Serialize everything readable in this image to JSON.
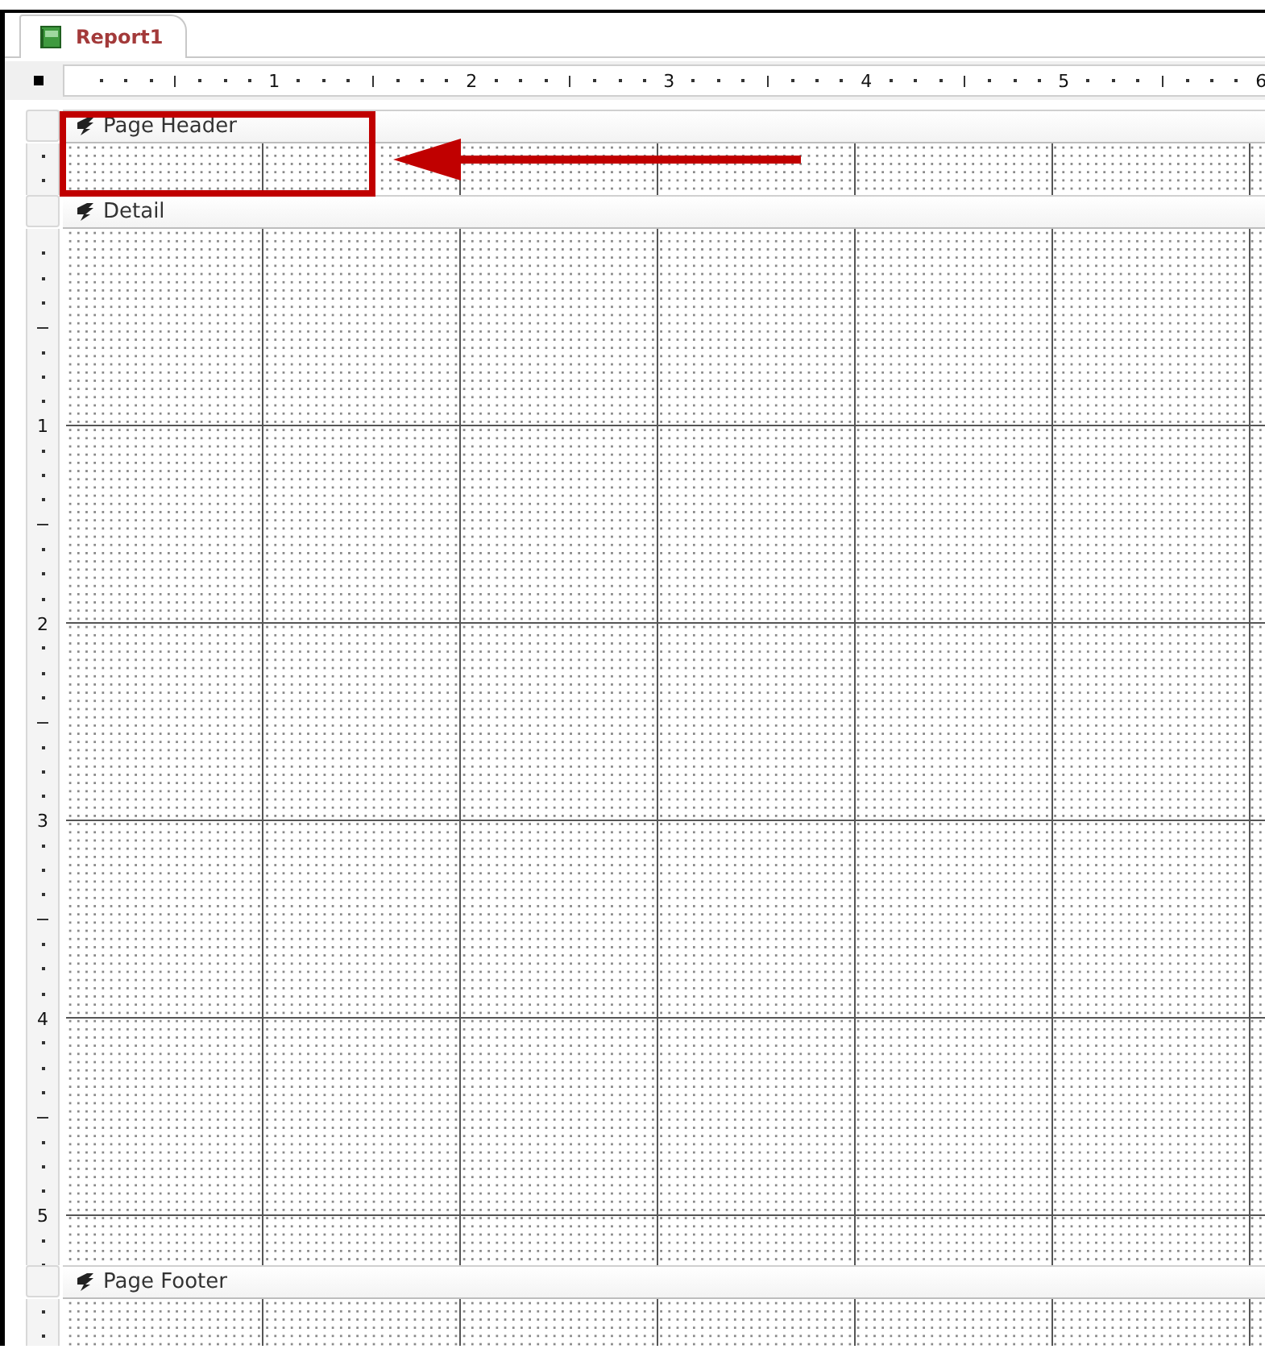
{
  "document_tab": {
    "title": "Report1",
    "selected": true
  },
  "horizontal_ruler": {
    "labels": [
      "1",
      "2",
      "3",
      "4",
      "5",
      "6"
    ]
  },
  "sections": [
    {
      "title": "Page Header"
    },
    {
      "title": "Detail",
      "ruler_labels": [
        "1",
        "2",
        "3",
        "4",
        "5"
      ]
    },
    {
      "title": "Page Footer"
    }
  ],
  "annotations": {
    "highlight_box": true,
    "arrow": true
  }
}
